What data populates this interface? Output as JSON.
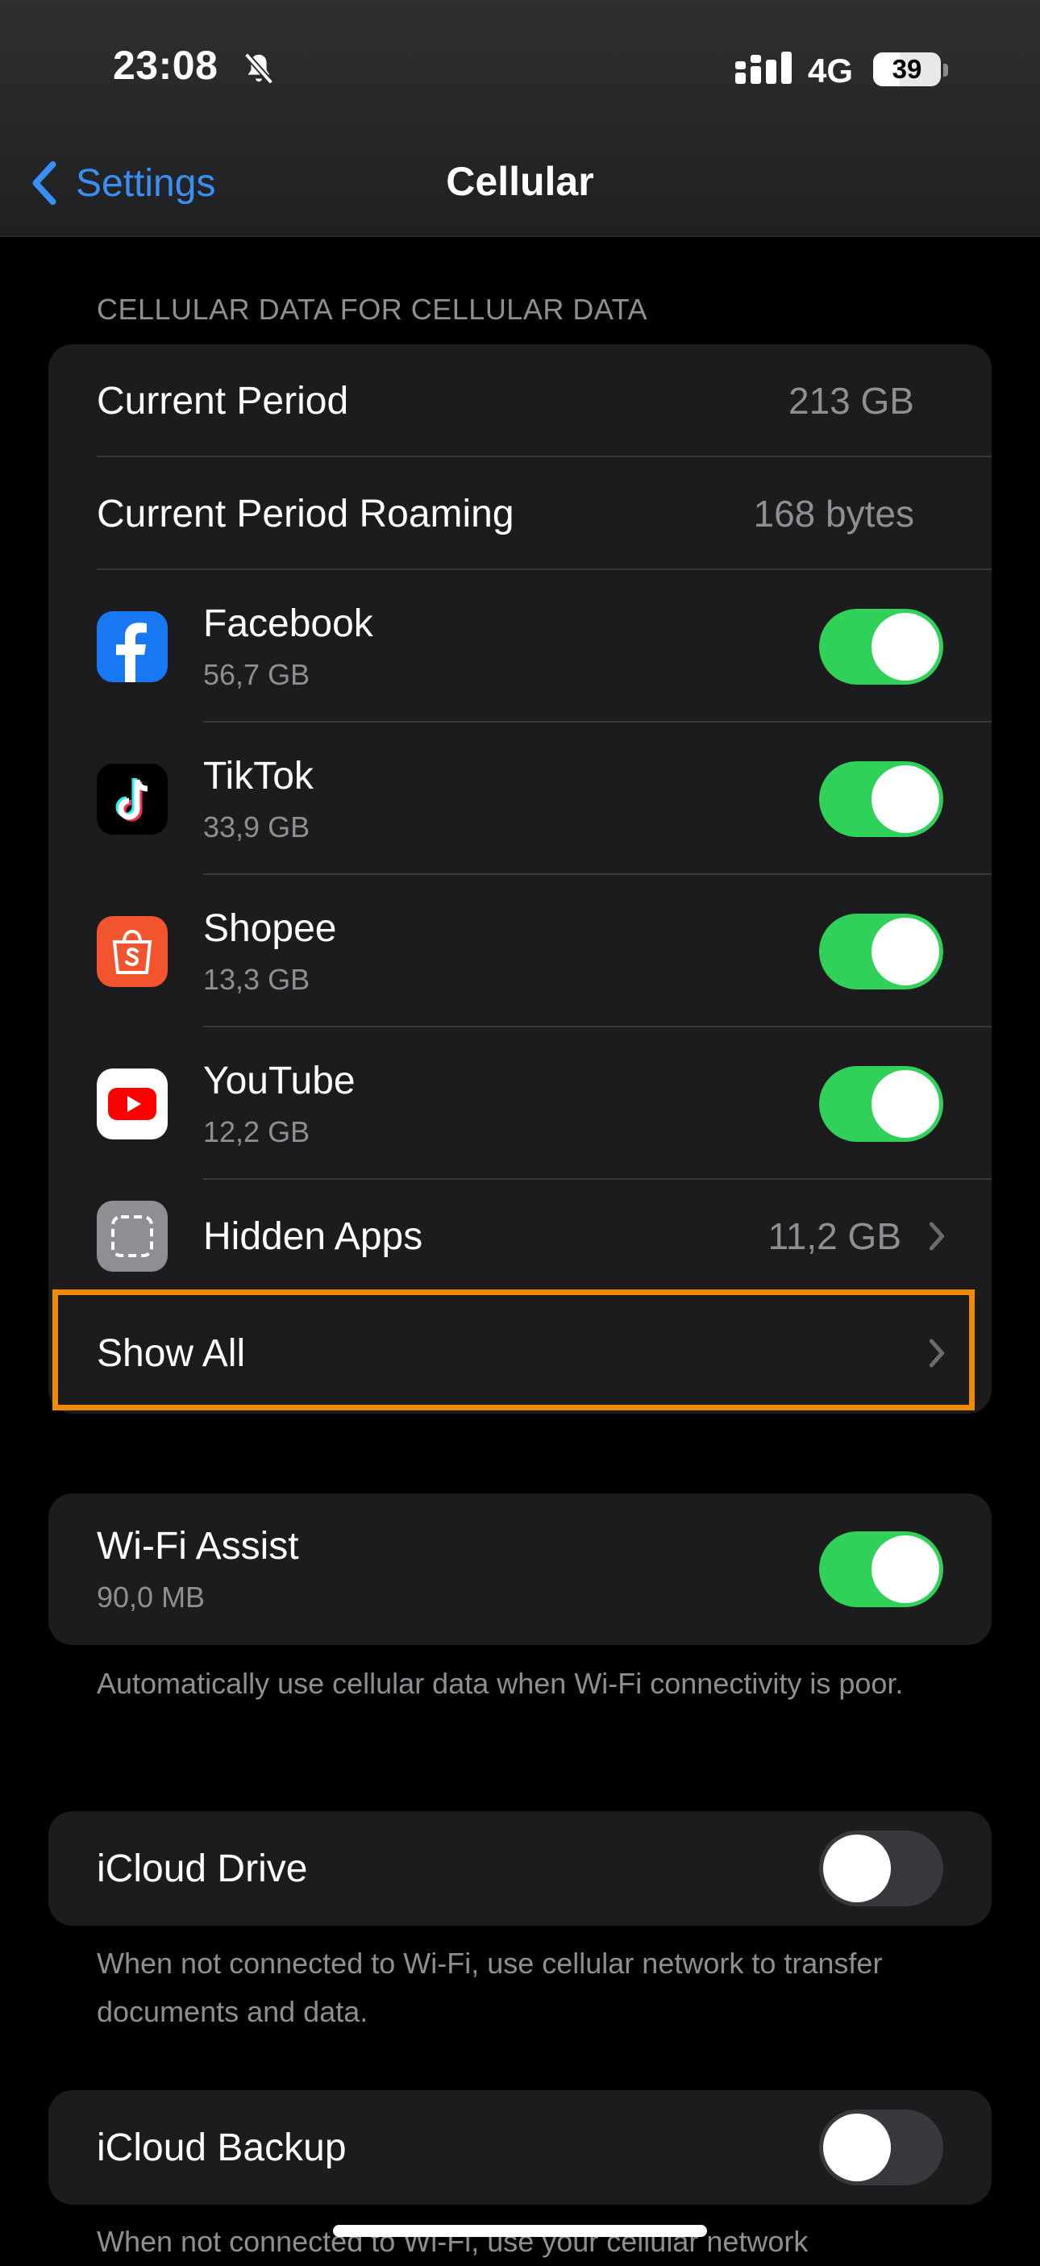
{
  "status_bar": {
    "time": "23:08",
    "network": "4G",
    "battery": "39",
    "battery_level": 0.39,
    "icons": [
      "bell-slash-icon",
      "signal-icon",
      "battery-icon"
    ]
  },
  "nav": {
    "back_label": "Settings",
    "title": "Cellular"
  },
  "usage_section": {
    "header": "CELLULAR DATA FOR CELLULAR DATA",
    "current_period_label": "Current Period",
    "current_period_value": "213 GB",
    "roaming_label": "Current Period Roaming",
    "roaming_value": "168 bytes",
    "apps": [
      {
        "name": "Facebook",
        "usage": "56,7 GB",
        "enabled": true,
        "icon": "facebook-icon"
      },
      {
        "name": "TikTok",
        "usage": "33,9 GB",
        "enabled": true,
        "icon": "tiktok-icon"
      },
      {
        "name": "Shopee",
        "usage": "13,3 GB",
        "enabled": true,
        "icon": "shopee-icon"
      },
      {
        "name": "YouTube",
        "usage": "12,2 GB",
        "enabled": true,
        "icon": "youtube-icon"
      }
    ],
    "hidden_apps_label": "Hidden Apps",
    "hidden_apps_value": "11,2 GB",
    "show_all_label": "Show All"
  },
  "wifi_assist": {
    "label": "Wi-Fi Assist",
    "usage": "90,0 MB",
    "enabled": true,
    "footer": "Automatically use cellular data when Wi-Fi connectivity is poor."
  },
  "icloud_drive": {
    "label": "iCloud Drive",
    "enabled": false,
    "footer": "When not connected to Wi-Fi, use cellular network to transfer documents and data."
  },
  "icloud_backup": {
    "label": "iCloud Backup",
    "enabled": false,
    "footer": "When not connected to Wi-Fi, use your cellular network"
  },
  "colors": {
    "accent": "#3a8ff5",
    "toggle_on": "#30d158",
    "highlight": "#f08a00"
  }
}
